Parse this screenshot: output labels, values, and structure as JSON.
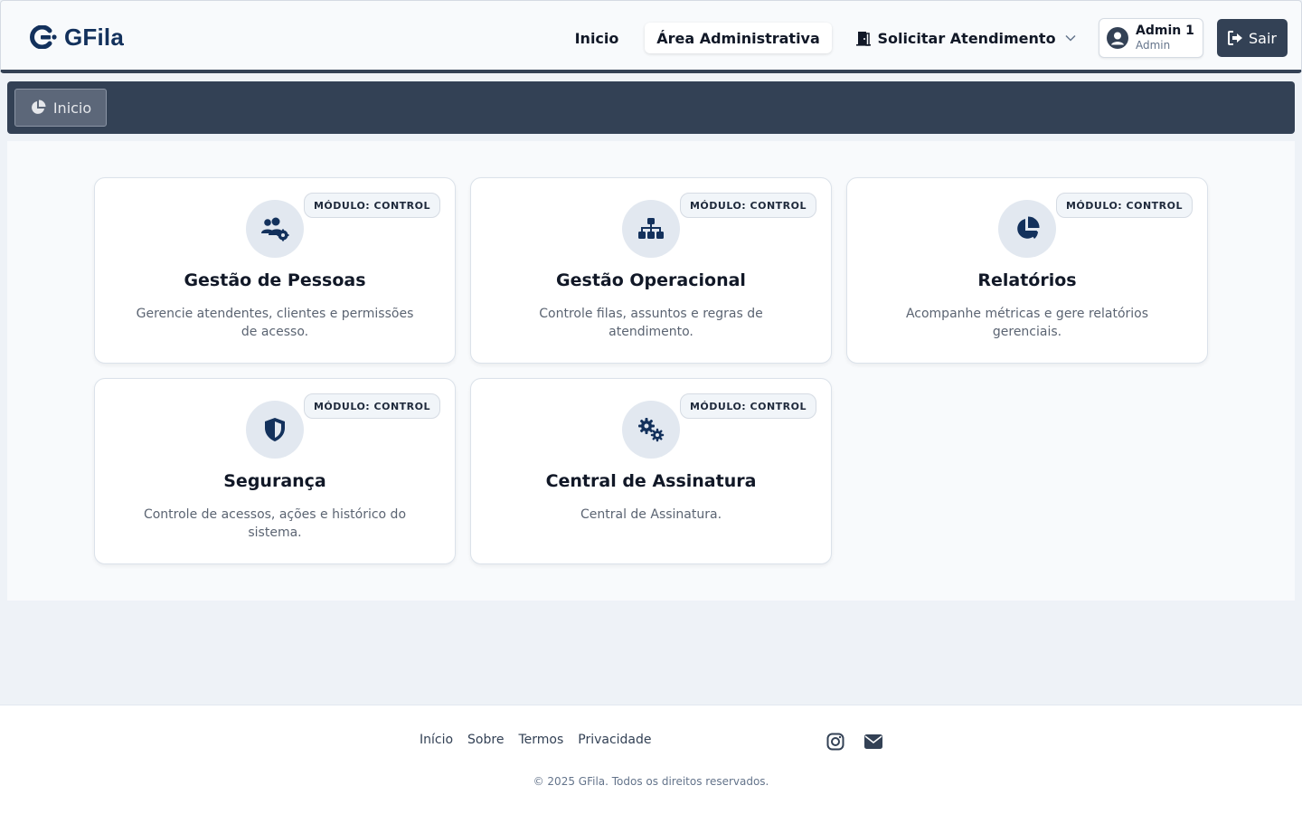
{
  "brand": {
    "name": "GFila"
  },
  "nav": {
    "inicio": "Inicio",
    "admin": "Área Administrativa",
    "solicitar": "Solicitar Atendimento"
  },
  "user": {
    "name": "Admin 1",
    "role": "Admin"
  },
  "logout_label": "Sair",
  "breadcrumb": {
    "label": "Inicio"
  },
  "cards": [
    {
      "badge": "MÓDULO: CONTROL",
      "icon": "users-gear-icon",
      "title": "Gestão de Pessoas",
      "desc": "Gerencie atendentes, clientes e permissões de acesso."
    },
    {
      "badge": "MÓDULO: CONTROL",
      "icon": "sitemap-icon",
      "title": "Gestão Operacional",
      "desc": "Controle filas, assuntos e regras de atendimento."
    },
    {
      "badge": "MÓDULO: CONTROL",
      "icon": "pie-chart-icon",
      "title": "Relatórios",
      "desc": "Acompanhe métricas e gere relatórios gerenciais."
    },
    {
      "badge": "MÓDULO: CONTROL",
      "icon": "shield-icon",
      "title": "Segurança",
      "desc": "Controle de acessos, ações e histórico do sistema."
    },
    {
      "badge": "MÓDULO: CONTROL",
      "icon": "gears-icon",
      "title": "Central de Assinatura",
      "desc": "Central de Assinatura."
    }
  ],
  "footer": {
    "links": [
      "Início",
      "Sobre",
      "Termos",
      "Privacidade"
    ],
    "copyright": "© 2025 GFila. Todos os direitos reservados."
  },
  "colors": {
    "primary": "#334155",
    "brand": "#13315c",
    "icon_bg": "#e2e8f0",
    "page_bg": "#eef2f7"
  }
}
